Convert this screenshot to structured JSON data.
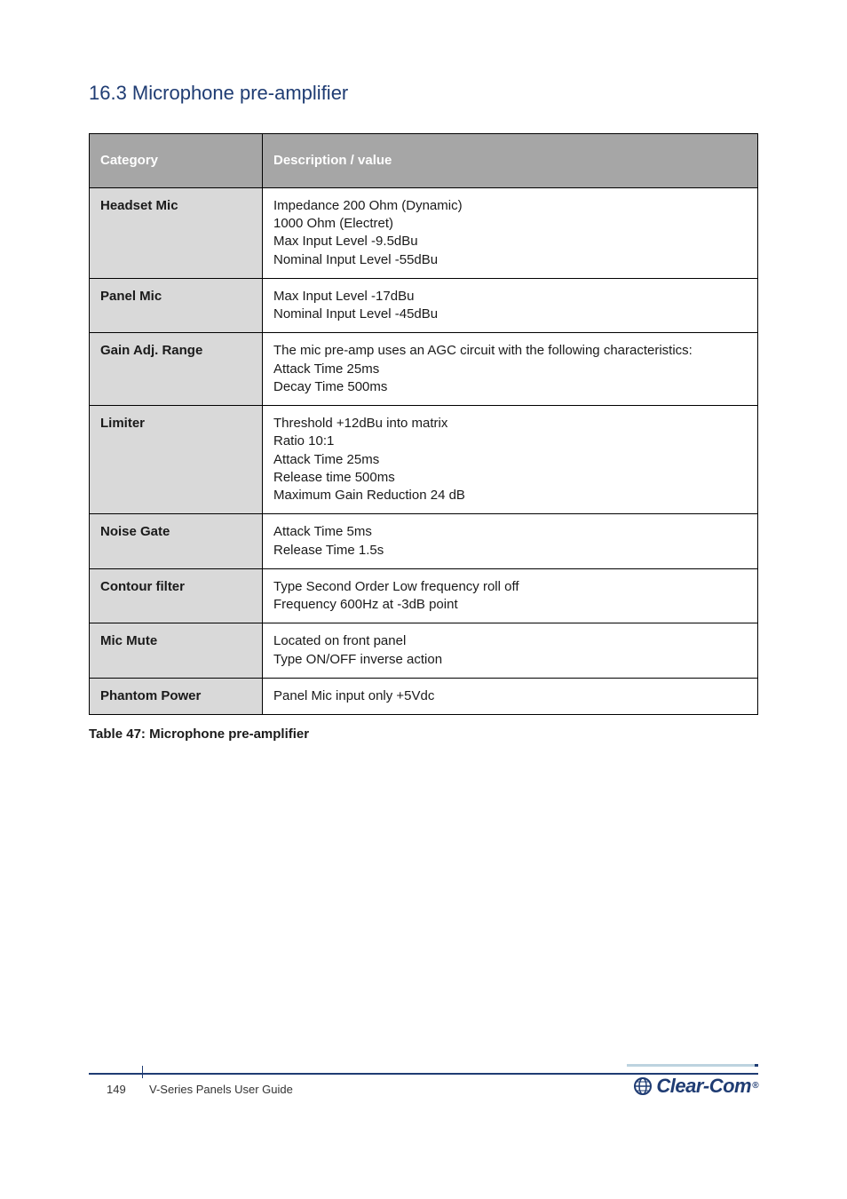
{
  "section_title": "16.3 Microphone pre-amplifier",
  "table": {
    "header_col1": "Category",
    "header_col2": "Description / value",
    "rows": [
      {
        "cat": "Headset Mic",
        "desc": "Impedance 200 Ohm (Dynamic)\n1000 Ohm (Electret)\nMax Input Level -9.5dBu\nNominal Input Level -55dBu"
      },
      {
        "cat": "Panel Mic",
        "desc": "Max Input Level -17dBu\nNominal Input Level -45dBu"
      },
      {
        "cat": "Gain Adj. Range",
        "desc": "The mic pre-amp uses an AGC circuit with the following characteristics:\nAttack Time 25ms\nDecay Time 500ms"
      },
      {
        "cat": "Limiter",
        "desc": "Threshold +12dBu into matrix\nRatio 10:1\nAttack Time 25ms\nRelease time 500ms\nMaximum Gain Reduction 24 dB"
      },
      {
        "cat": "Noise Gate",
        "desc": "Attack Time 5ms\nRelease Time 1.5s"
      },
      {
        "cat": "Contour filter",
        "desc": "Type Second Order Low frequency roll off\nFrequency 600Hz at -3dB point"
      },
      {
        "cat": "Mic Mute",
        "desc": "Located on front panel\nType ON/OFF inverse action"
      },
      {
        "cat": "Phantom Power",
        "desc": "Panel Mic input only +5Vdc"
      }
    ]
  },
  "table_caption": "Table 47: Microphone pre-amplifier",
  "footer": {
    "page_number": "149",
    "doc_title": "V-Series Panels User Guide",
    "logo_text": "Clear-Com"
  }
}
